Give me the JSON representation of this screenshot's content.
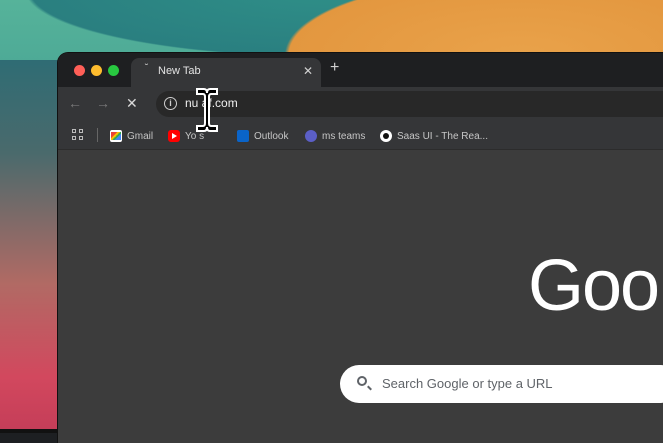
{
  "tab": {
    "title": "New Tab"
  },
  "toolbar": {
    "back_icon": "←",
    "forward_icon": "→",
    "stop_icon": "✕",
    "address": "nu    af.com"
  },
  "bookmarks": [
    {
      "label": "Gmail",
      "icon": "gmail-icon"
    },
    {
      "label": "Yo    s",
      "icon": "youtube-icon"
    },
    {
      "label": "Outlook",
      "icon": "outlook-icon"
    },
    {
      "label": "ms teams",
      "icon": "teams-icon"
    },
    {
      "label": "Saas UI - The Rea...",
      "icon": "saas-ui-icon"
    }
  ],
  "new_tab_page": {
    "logo_text": "Goo",
    "search_placeholder": "Search Google or type a URL"
  },
  "colors": {
    "tab_bar": "#1e1f21",
    "toolbar": "#353638",
    "page_background": "#3c3c3c"
  }
}
